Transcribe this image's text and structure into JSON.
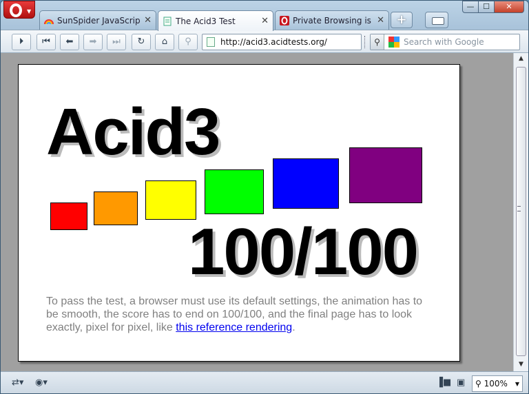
{
  "tabs": [
    {
      "title": "SunSpider JavaScript ...",
      "active": false
    },
    {
      "title": "The Acid3 Test",
      "active": true
    },
    {
      "title": "Private Browsing is e...",
      "active": false
    }
  ],
  "tab_close_glyph": "✕",
  "new_tab_glyph": "+",
  "window_controls": {
    "minimize": "—",
    "maximize": "☐",
    "close": "✕"
  },
  "toolbar": {
    "buttons": [
      {
        "name": "fast-forward-icon",
        "glyph": "⏵",
        "enabled": true
      },
      {
        "name": "rewind-icon",
        "glyph": "⏮",
        "enabled": true
      },
      {
        "name": "back-icon",
        "glyph": "⬅",
        "enabled": true
      },
      {
        "name": "forward-icon",
        "glyph": "➡",
        "enabled": false
      },
      {
        "name": "skip-forward-icon",
        "glyph": "⏭",
        "enabled": false
      },
      {
        "name": "reload-icon",
        "glyph": "↻",
        "enabled": true
      },
      {
        "name": "home-icon",
        "glyph": "⌂",
        "enabled": true
      },
      {
        "name": "wand-icon",
        "glyph": "⚲",
        "enabled": false
      }
    ],
    "address": "http://acid3.acidtests.org/",
    "search_placeholder": "Search with Google"
  },
  "page": {
    "title": "Acid3",
    "score": "100/100",
    "description": "To pass the test, a browser must use its default settings, the animation has to be smooth, the score has to end on 100/100, and the final page has to look exactly, pixel for pixel, like ",
    "link_text": "this reference rendering",
    "after_link": ".",
    "boxes": [
      {
        "color": "#ff0000"
      },
      {
        "color": "#ff9900"
      },
      {
        "color": "#ffff00"
      },
      {
        "color": "#00ff00"
      },
      {
        "color": "#0000ff"
      },
      {
        "color": "#800080"
      }
    ]
  },
  "status": {
    "zoom": "100%"
  },
  "colors": {
    "opera_red": "#c8161d",
    "link": "#0000ee",
    "description_text": "#808080"
  }
}
